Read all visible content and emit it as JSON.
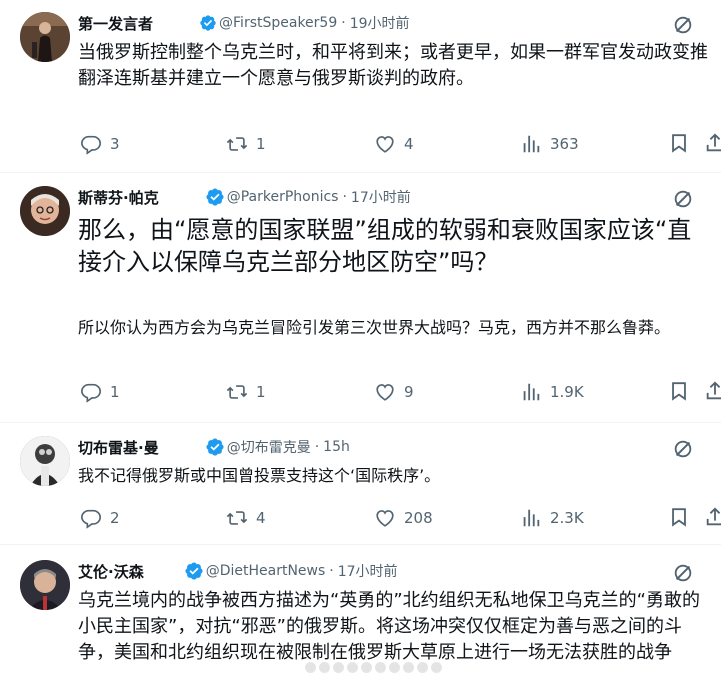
{
  "tweets": [
    {
      "name": "第一发言者",
      "handle": "@FirstSpeaker59",
      "time": "19小时前",
      "text": "当俄罗斯控制整个乌克兰时，和平将到来；或者更早，如果一群军官发动政变推翻泽连斯基并建立一个愿意与俄罗斯谈判的政府。",
      "replies": "3",
      "retweets": "1",
      "likes": "4",
      "views": "363"
    },
    {
      "name": "斯蒂芬·帕克",
      "handle": "@ParkerPhonics",
      "time": "17小时前",
      "quote": "那么，由“愿意的国家联盟”组成的软弱和衰败国家应该“直接介入以保障乌克兰部分地区防空”吗？",
      "text": "所以你认为西方会为乌克兰冒险引发第三次世界大战吗？马克，西方并不那么鲁莽。",
      "replies": "1",
      "retweets": "1",
      "likes": "9",
      "views": "1.9K"
    },
    {
      "name": "切布雷基·曼",
      "handle": "@切布雷克曼",
      "time": "15h",
      "text": "我不记得俄罗斯或中国曾投票支持这个‘国际秩序’。",
      "replies": "2",
      "retweets": "4",
      "likes": "208",
      "views": "2.3K"
    },
    {
      "name": "艾伦·沃森",
      "handle": "@DietHeartNews",
      "time": "17小时前",
      "text": "乌克兰境内的战争被西方描述为“英勇的”北约组织无私地保卫乌克兰的“勇敢的小民主国家”，对抗“邪恶”的俄罗斯。将这场冲突仅仅框定为善与恶之间的斗争，美国和北约组织现在被限制在俄罗斯大草原上进行一场无法获胜的战争"
    }
  ],
  "colors": {
    "verified": "#1d9bf0",
    "secondary": "#536471",
    "text": "#0f1419"
  },
  "icons": [
    "reply-icon",
    "retweet-icon",
    "like-icon",
    "views-icon",
    "bookmark-icon",
    "share-icon",
    "grok-icon",
    "verified-badge-icon"
  ]
}
